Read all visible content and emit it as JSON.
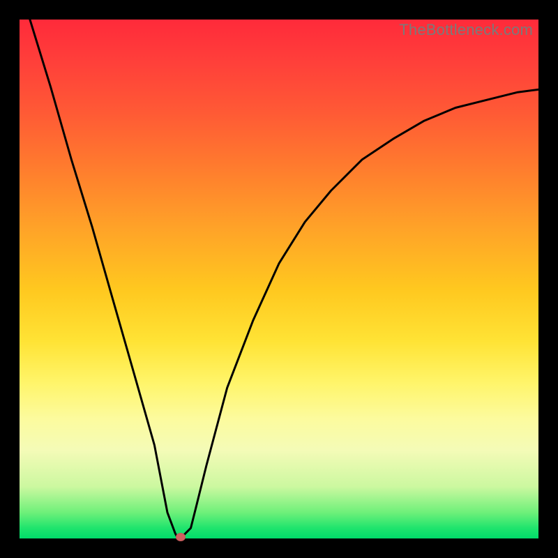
{
  "watermark": "TheBottleneck.com",
  "chart_data": {
    "type": "line",
    "title": "",
    "xlabel": "",
    "ylabel": "",
    "xlim": [
      0,
      1
    ],
    "ylim": [
      0,
      1
    ],
    "grid": false,
    "legend": false,
    "colors": {
      "line": "#000000",
      "marker": "#d06060",
      "gradient_top": "#ff2a3a",
      "gradient_bottom": "#00dc6a"
    },
    "series": [
      {
        "name": "bottleneck-curve",
        "x": [
          0.02,
          0.06,
          0.1,
          0.14,
          0.18,
          0.22,
          0.26,
          0.285,
          0.3,
          0.305,
          0.31,
          0.33,
          0.34,
          0.36,
          0.4,
          0.45,
          0.5,
          0.55,
          0.6,
          0.66,
          0.72,
          0.78,
          0.84,
          0.9,
          0.96,
          1.0
        ],
        "y": [
          1.0,
          0.87,
          0.73,
          0.6,
          0.46,
          0.32,
          0.18,
          0.05,
          0.01,
          0.0,
          0.0,
          0.02,
          0.06,
          0.14,
          0.29,
          0.42,
          0.53,
          0.61,
          0.67,
          0.73,
          0.77,
          0.805,
          0.83,
          0.845,
          0.86,
          0.865
        ]
      }
    ],
    "marker_point": {
      "x": 0.31,
      "y": 0.0
    },
    "notes": "y-values approximate relative bottleneck (0 = no bottleneck, 1 = worst); read off gradient bands since no numeric axes shown"
  }
}
